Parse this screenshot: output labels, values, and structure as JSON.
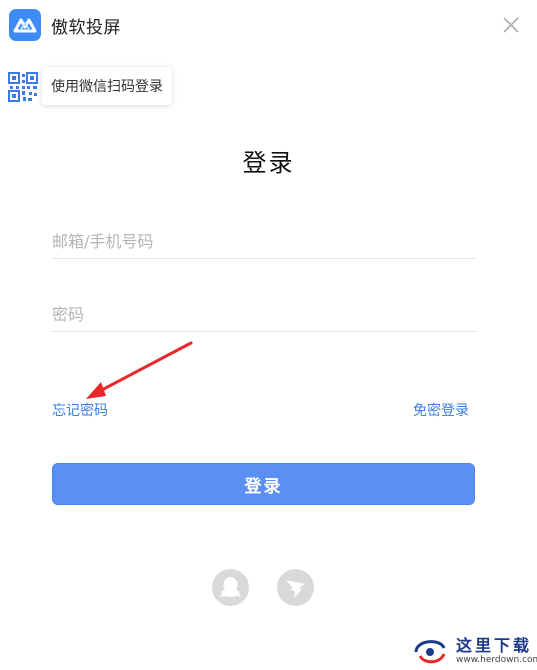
{
  "app": {
    "title": "傲软投屏",
    "brand_color": "#3d8cf5"
  },
  "header": {
    "wechat_tip": "使用微信扫码登录",
    "qr_icon": "qr-code-icon",
    "close_icon": "close-icon"
  },
  "form": {
    "heading": "登录",
    "email_placeholder": "邮箱/手机号码",
    "email_value": "",
    "password_placeholder": "密码",
    "password_value": "",
    "forgot_password": "忘记密码",
    "password_free_login": "免密登录",
    "submit_label": "登录",
    "accent_color": "#5b8ff4",
    "link_color": "#3a7de0"
  },
  "social": {
    "items": [
      {
        "name": "qq-icon"
      },
      {
        "name": "dingtalk-icon"
      }
    ]
  },
  "annotation": {
    "arrow_color": "#e8282a"
  },
  "watermark": {
    "text": "这里下载",
    "url": "www.herdown.com"
  }
}
